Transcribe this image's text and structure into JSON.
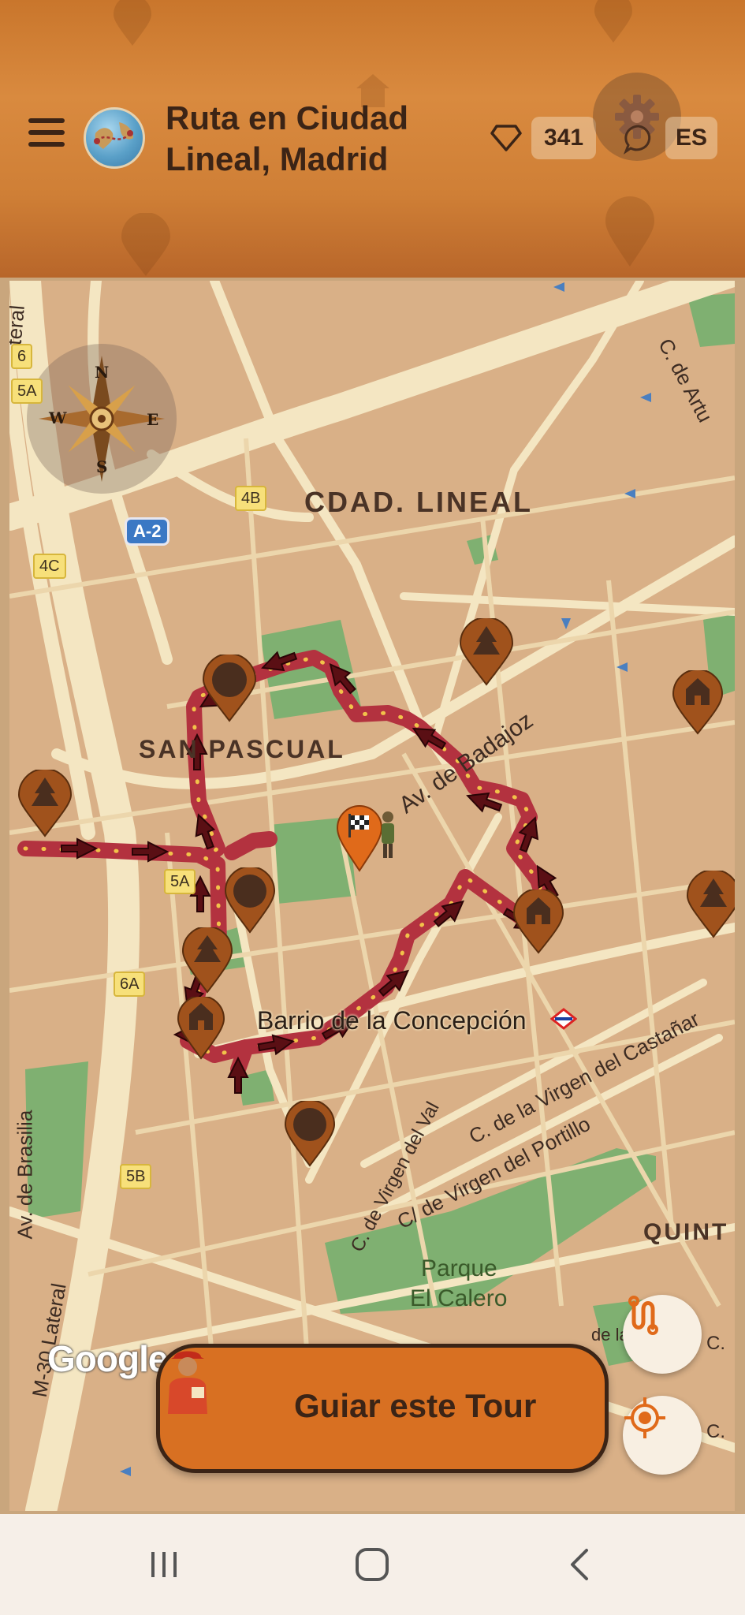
{
  "header": {
    "title": "Ruta en Ciudad Lineal, Madrid",
    "points": "341",
    "language": "ES",
    "icons": [
      "menu-icon",
      "globe-logo-icon",
      "gem-icon",
      "settings-gear-icon",
      "chat-icon"
    ]
  },
  "map": {
    "district_labels": [
      "CDAD. LINEAL",
      "SAN PASCUAL",
      "QUINT"
    ],
    "street_labels": {
      "av_badajoz": "Av. de Badajoz",
      "barrio": "Barrio de la Concepción",
      "castanar": "C. de la Virgen del Castañar",
      "portillo": "C/ de Virgen del Portillo",
      "val": "C. de Virgen del Val",
      "brasilia": "Av. de Brasilia",
      "m30": "M-30 Lateral",
      "arturo": "C. de Artu",
      "lateral_top": "teral",
      "parque": "Parque",
      "calero": "El Calero",
      "c_right1": "C.",
      "c_right2": "C.",
      "de_la": "de la"
    },
    "road_badges": [
      "6",
      "5A",
      "4B",
      "4C",
      "5A",
      "6A",
      "5B"
    ],
    "highway_badge": "A-2",
    "compass_letters": {
      "n": "N",
      "s": "S",
      "e": "E",
      "w": "W"
    },
    "google_attribution": "Google",
    "route_color": "#b3323f",
    "marker_color": "#a0521c"
  },
  "actions": {
    "guide_button": "Guiar este Tour",
    "route_toggle_icon": "route-icon",
    "locate_icon": "my-location-icon"
  },
  "system_nav": {
    "recents": "recent-apps-icon",
    "home": "home-icon",
    "back": "back-icon"
  }
}
